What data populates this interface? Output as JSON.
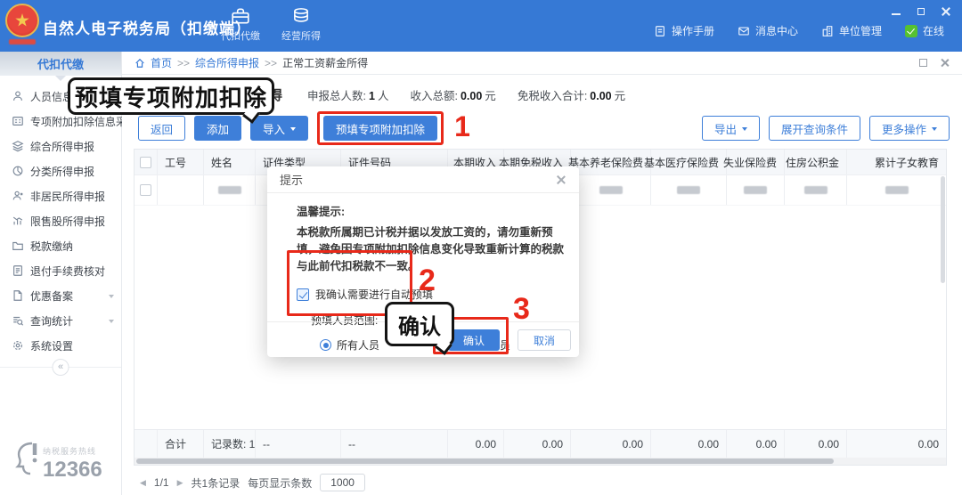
{
  "titlebar": {
    "app_title": "自然人电子税务局（扣缴端）",
    "nav": [
      {
        "label": "代扣代缴"
      },
      {
        "label": "经营所得"
      }
    ],
    "links": [
      {
        "label": "操作手册"
      },
      {
        "label": "消息中心"
      },
      {
        "label": "单位管理"
      },
      {
        "label": "在线"
      }
    ]
  },
  "sidebar": {
    "header": "代扣代缴",
    "items": [
      {
        "label": "人员信息采集"
      },
      {
        "label": "专项附加扣除信息采集"
      },
      {
        "label": "综合所得申报"
      },
      {
        "label": "分类所得申报"
      },
      {
        "label": "非居民所得申报"
      },
      {
        "label": "限售股所得申报"
      },
      {
        "label": "税款缴纳"
      },
      {
        "label": "退付手续费核对"
      },
      {
        "label": "优惠备案"
      },
      {
        "label": "查询统计"
      },
      {
        "label": "系统设置"
      }
    ],
    "collapse": "«",
    "hotline_label": "纳税服务热线",
    "hotline_number": "12366"
  },
  "breadcrumb": {
    "home": "首页",
    "sep1": ">>",
    "section": "综合所得申报",
    "sep2": ">>",
    "current": "正常工资薪金所得"
  },
  "page": {
    "title": "正常工资薪金所得",
    "stats": [
      {
        "label": "申报总人数:",
        "value": "1",
        "unit": "人"
      },
      {
        "label": "收入总额:",
        "value": "0.00",
        "unit": "元"
      },
      {
        "label": "免税收入合计:",
        "value": "0.00",
        "unit": "元"
      }
    ]
  },
  "toolbar": {
    "back": "返回",
    "add": "添加",
    "import": "导入",
    "prefill": "预填专项附加扣除",
    "export": "导出",
    "expand_query": "展开查询条件",
    "more": "更多操作"
  },
  "table": {
    "columns": [
      "工号",
      "姓名",
      "证件类型",
      "证件号码",
      "本期收入",
      "本期免税收入",
      "基本养老保险费",
      "基本医疗保险费",
      "失业保险费",
      "住房公积金",
      "累计子女教育"
    ],
    "summary": {
      "label": "合计",
      "records": "记录数: 1",
      "cert_type": "--",
      "cert_no": "--",
      "values": [
        "0.00",
        "0.00",
        "0.00",
        "0.00",
        "0.00",
        "0.00",
        "0.00"
      ]
    }
  },
  "pagination": {
    "prev": "◀",
    "page": "1/1",
    "next": "▶",
    "total": "共1条记录",
    "per_page_label": "每页显示条数",
    "per_page_value": "1000"
  },
  "modal": {
    "title": "提示",
    "warm_title": "温馨提示:",
    "message": "本税款所属期已计税并据以发放工资的，请勿重新预填，避免因专项附加扣除信息变化导致重新计算的税款与此前代扣税款不一致。",
    "confirm_checkbox": "我确认需要进行自动预填",
    "scope_label": "预填人员范围:",
    "radio_all": "所有人员",
    "radio_selected": "选中人员",
    "confirm": "确认",
    "cancel": "取消"
  },
  "annotations": {
    "callout_prefill": "预填专项附加扣除",
    "callout_confirm": "确认",
    "step1": "1",
    "step2": "2",
    "step3": "3"
  },
  "colors": {
    "header_blue": "#3679d5",
    "primary_blue": "#3e7fd9",
    "annotation_red": "#e8291a",
    "online_green": "#56c230"
  }
}
